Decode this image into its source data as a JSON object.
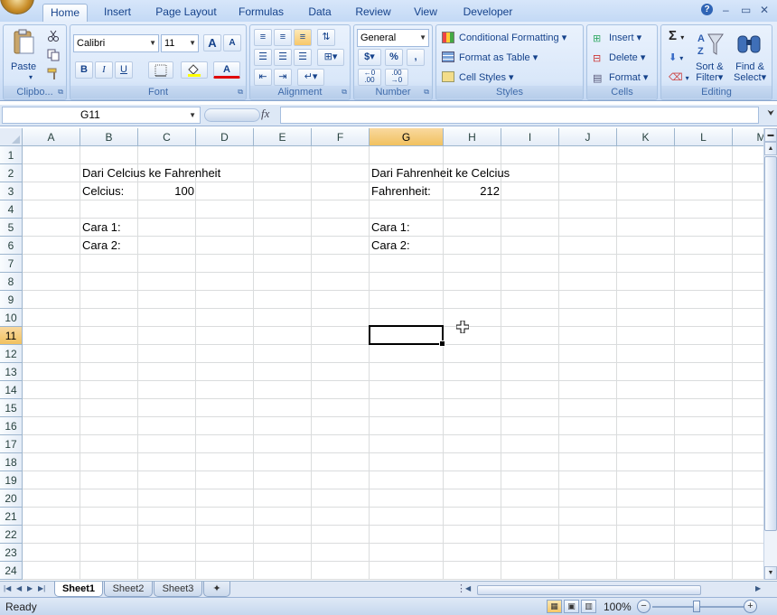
{
  "tabs": [
    "Home",
    "Insert",
    "Page Layout",
    "Formulas",
    "Data",
    "Review",
    "View",
    "Developer"
  ],
  "window_controls": {
    "help": "?",
    "minimize": "–",
    "restore": "▭",
    "close": "✕"
  },
  "ribbon": {
    "clipboard": {
      "label": "Clipbo...",
      "paste": "Paste",
      "cut_icon": "scissors-icon",
      "copy_icon": "copy-icon",
      "format_painter_icon": "brush-icon"
    },
    "font": {
      "label": "Font",
      "font_name": "Calibri",
      "font_size": "11",
      "grow": "A",
      "shrink": "A",
      "bold": "B",
      "italic": "I",
      "underline": "U",
      "font_color": "A"
    },
    "alignment": {
      "label": "Alignment"
    },
    "number": {
      "label": "Number",
      "format": "General",
      "currency": "$",
      "percent": "%",
      "comma": ",",
      "inc_decimal": "+.0\n.00",
      "dec_decimal": ".00\n→.0"
    },
    "styles": {
      "label": "Styles",
      "conditional": "Conditional Formatting",
      "format_table": "Format as Table",
      "cell_styles": "Cell Styles"
    },
    "cells": {
      "label": "Cells",
      "insert": "Insert",
      "delete": "Delete",
      "format": "Format"
    },
    "editing": {
      "label": "Editing",
      "sum": "Σ",
      "sort_filter_1": "Sort &",
      "sort_filter_2": "Filter",
      "find_select_1": "Find &",
      "find_select_2": "Select"
    }
  },
  "formula_bar": {
    "name_box": "G11",
    "fx": "fx",
    "content": ""
  },
  "columns": [
    "A",
    "B",
    "C",
    "D",
    "E",
    "F",
    "G",
    "H",
    "I",
    "J",
    "K",
    "L",
    "M"
  ],
  "rows": [
    "1",
    "2",
    "3",
    "4",
    "5",
    "6",
    "7",
    "8",
    "9",
    "10",
    "11",
    "12",
    "13",
    "14",
    "15",
    "16",
    "17",
    "18",
    "19",
    "20",
    "21",
    "22",
    "23",
    "24"
  ],
  "selected_column": "G",
  "selected_row": "11",
  "cells": {
    "b2": "Dari Celcius ke Fahrenheit",
    "b3": "Celcius:",
    "c3": "100",
    "b5": "Cara 1:",
    "b6": "Cara 2:",
    "g2": "Dari Fahrenheit ke Celcius",
    "g3": "Fahrenheit:",
    "h3": "212",
    "g5": "Cara 1:",
    "g6": "Cara 2:"
  },
  "sheets": [
    "Sheet1",
    "Sheet2",
    "Sheet3"
  ],
  "active_sheet": "Sheet1",
  "status": {
    "ready": "Ready",
    "zoom": "100%",
    "zoom_minus": "−",
    "zoom_plus": "+"
  }
}
